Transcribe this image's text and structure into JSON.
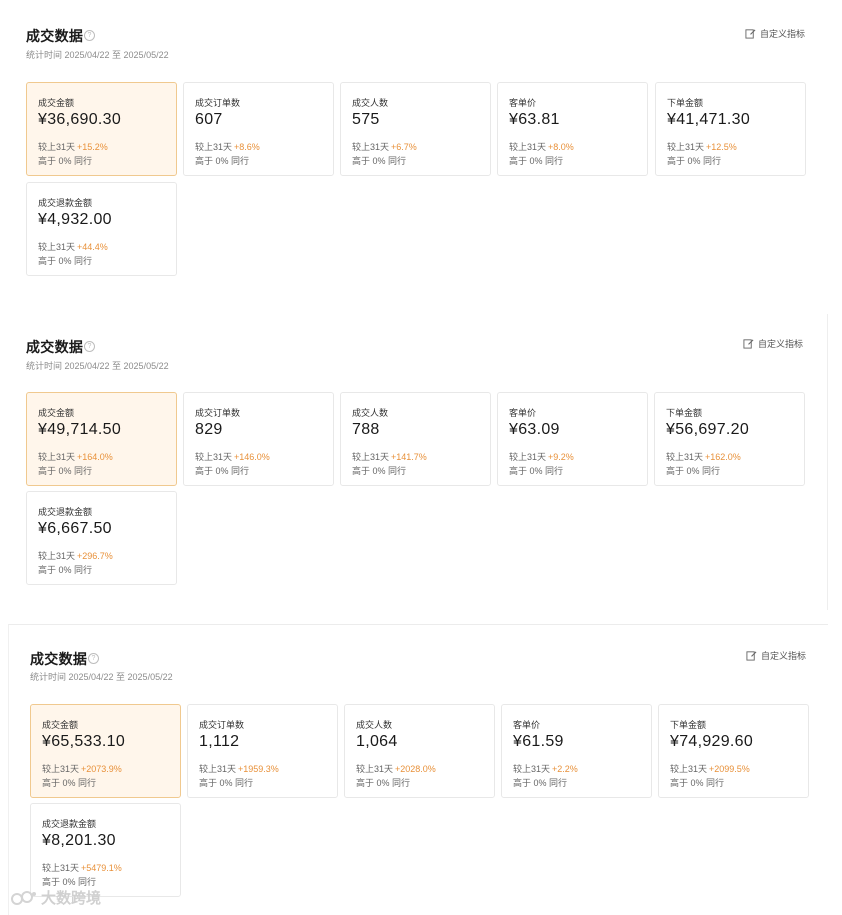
{
  "panels": [
    {
      "title": "成交数据",
      "period": "统计时间 2025/04/22 至 2025/05/22",
      "custom_label": "自定义指标",
      "cards": [
        {
          "label": "成交金额",
          "value": "¥36,690.30",
          "compare_prefix": "较上31天",
          "change": "+15.2%",
          "peer": "高于 0% 同行"
        },
        {
          "label": "成交订单数",
          "value": "607",
          "compare_prefix": "较上31天",
          "change": "+8.6%",
          "peer": "高于 0% 同行"
        },
        {
          "label": "成交人数",
          "value": "575",
          "compare_prefix": "较上31天",
          "change": "+6.7%",
          "peer": "高于 0% 同行"
        },
        {
          "label": "客单价",
          "value": "¥63.81",
          "compare_prefix": "较上31天",
          "change": "+8.0%",
          "peer": "高于 0% 同行"
        },
        {
          "label": "下单金额",
          "value": "¥41,471.30",
          "compare_prefix": "较上31天",
          "change": "+12.5%",
          "peer": "高于 0% 同行"
        },
        {
          "label": "成交退款金额",
          "value": "¥4,932.00",
          "compare_prefix": "较上31天",
          "change": "+44.4%",
          "peer": "高于 0% 同行"
        }
      ]
    },
    {
      "title": "成交数据",
      "period": "统计时间 2025/04/22 至 2025/05/22",
      "custom_label": "自定义指标",
      "cards": [
        {
          "label": "成交金额",
          "value": "¥49,714.50",
          "compare_prefix": "较上31天",
          "change": "+164.0%",
          "peer": "高于 0% 同行"
        },
        {
          "label": "成交订单数",
          "value": "829",
          "compare_prefix": "较上31天",
          "change": "+146.0%",
          "peer": "高于 0% 同行"
        },
        {
          "label": "成交人数",
          "value": "788",
          "compare_prefix": "较上31天",
          "change": "+141.7%",
          "peer": "高于 0% 同行"
        },
        {
          "label": "客单价",
          "value": "¥63.09",
          "compare_prefix": "较上31天",
          "change": "+9.2%",
          "peer": "高于 0% 同行"
        },
        {
          "label": "下单金额",
          "value": "¥56,697.20",
          "compare_prefix": "较上31天",
          "change": "+162.0%",
          "peer": "高于 0% 同行"
        },
        {
          "label": "成交退款金额",
          "value": "¥6,667.50",
          "compare_prefix": "较上31天",
          "change": "+296.7%",
          "peer": "高于 0% 同行"
        }
      ]
    },
    {
      "title": "成交数据",
      "period": "统计时间 2025/04/22 至 2025/05/22",
      "custom_label": "自定义指标",
      "cards": [
        {
          "label": "成交金额",
          "value": "¥65,533.10",
          "compare_prefix": "较上31天",
          "change": "+2073.9%",
          "peer": "高于 0% 同行"
        },
        {
          "label": "成交订单数",
          "value": "1,112",
          "compare_prefix": "较上31天",
          "change": "+1959.3%",
          "peer": "高于 0% 同行"
        },
        {
          "label": "成交人数",
          "value": "1,064",
          "compare_prefix": "较上31天",
          "change": "+2028.0%",
          "peer": "高于 0% 同行"
        },
        {
          "label": "客单价",
          "value": "¥61.59",
          "compare_prefix": "较上31天",
          "change": "+2.2%",
          "peer": "高于 0% 同行"
        },
        {
          "label": "下单金额",
          "value": "¥74,929.60",
          "compare_prefix": "较上31天",
          "change": "+2099.5%",
          "peer": "高于 0% 同行"
        },
        {
          "label": "成交退款金额",
          "value": "¥8,201.30",
          "compare_prefix": "较上31天",
          "change": "+5479.1%",
          "peer": "高于 0% 同行"
        }
      ]
    }
  ],
  "watermark": "大数跨境",
  "colors": {
    "accent": "#e8913a",
    "active_bg": "#fff6eb",
    "active_border": "#f0c98f"
  },
  "icons": {
    "help": "question-circle-icon",
    "edit": "edit-icon"
  }
}
